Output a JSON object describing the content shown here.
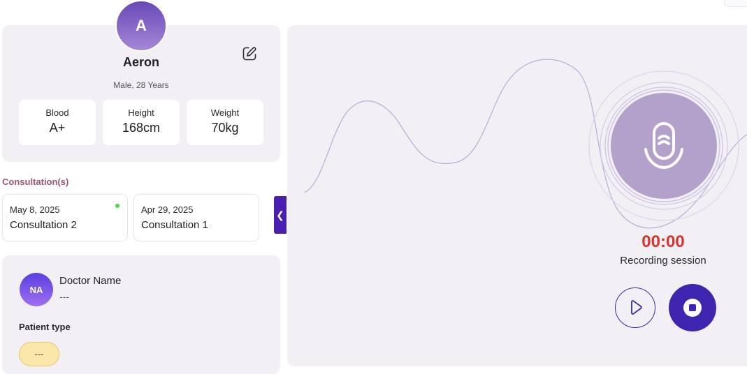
{
  "patient": {
    "initial": "A",
    "name": "Aeron",
    "summary": "Male, 28 Years",
    "stats": [
      {
        "label": "Blood",
        "value": "A+"
      },
      {
        "label": "Height",
        "value": "168cm"
      },
      {
        "label": "Weight",
        "value": "70kg"
      }
    ]
  },
  "consultations": {
    "heading": "Consultation(s)",
    "items": [
      {
        "date": "May 8, 2025",
        "title": "Consultation 2",
        "active": true
      },
      {
        "date": "Apr 29, 2025",
        "title": "Consultation 1",
        "active": false
      }
    ],
    "collapse_glyph": "❮"
  },
  "doctor": {
    "initials": "NA",
    "name": "Doctor Name",
    "value": "---",
    "patient_type_label": "Patient type",
    "patient_type_value": "---"
  },
  "recorder": {
    "timer": "00:00",
    "status": "Recording session"
  },
  "colors": {
    "accent": "#3f24b0",
    "timer": "#d9322b",
    "heading": "#a0566a",
    "active_dot": "#54d44a",
    "mic_circle": "#b3a1cc"
  }
}
